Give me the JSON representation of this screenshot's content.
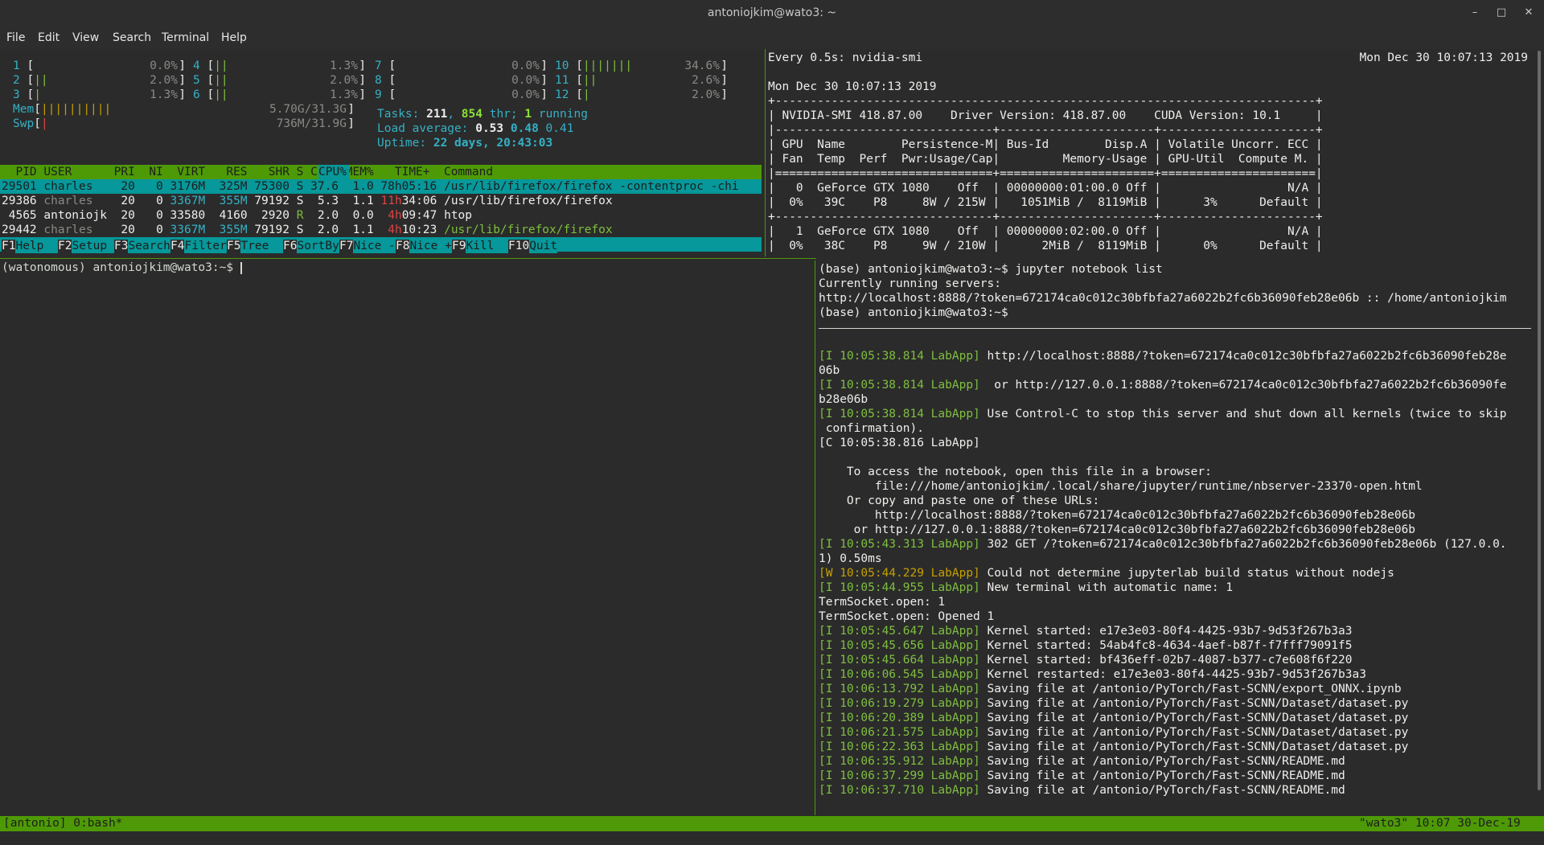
{
  "window": {
    "title": "antoniojkim@wato3: ~"
  },
  "menu": [
    "File",
    "Edit",
    "View",
    "Search",
    "Terminal",
    "Help"
  ],
  "htop": {
    "cpus": [
      {
        "id": "1",
        "pct": "0.0%",
        "bar": ""
      },
      {
        "id": "2",
        "pct": "2.0%",
        "bar": "||"
      },
      {
        "id": "3",
        "pct": "1.3%",
        "bar": "|"
      },
      {
        "id": "4",
        "pct": "1.3%",
        "bar": "||"
      },
      {
        "id": "5",
        "pct": "2.0%",
        "bar": "||"
      },
      {
        "id": "6",
        "pct": "1.3%",
        "bar": "||"
      },
      {
        "id": "7",
        "pct": "0.0%",
        "bar": ""
      },
      {
        "id": "8",
        "pct": "0.0%",
        "bar": ""
      },
      {
        "id": "9",
        "pct": "0.0%",
        "bar": ""
      },
      {
        "id": "10",
        "pct": "34.6%",
        "bar": "|||||||"
      },
      {
        "id": "11",
        "pct": "2.6%",
        "bar": "||"
      },
      {
        "id": "12",
        "pct": "2.0%",
        "bar": "|"
      }
    ],
    "mem": {
      "label": "Mem",
      "bar": "||||||||||",
      "value": "5.70G/31.3G"
    },
    "swp": {
      "label": "Swp",
      "bar": "|",
      "value": "736M/31.9G"
    },
    "tasks": {
      "label": "Tasks:",
      "count": "211",
      "thr": "854",
      "thr_label": "thr;",
      "running": "1",
      "running_label": "running"
    },
    "load": {
      "label": "Load average:",
      "l1": "0.53",
      "l5": "0.48",
      "l15": "0.41"
    },
    "uptime": {
      "label": "Uptime:",
      "value": "22 days, 20:43:03"
    },
    "header": "  PID USER      PRI  NI  VIRT   RES   SHR S CPU% MEM%   TIME+  Command",
    "processes": [
      {
        "pid": "29501",
        "user": "charles",
        "pri": "20",
        "ni": "0",
        "virt": "3176M",
        "res": "325M",
        "shr": "75300",
        "s": "S",
        "cpu": "37.6",
        "mem": "1.0",
        "time": "78h05:16",
        "cmd": "/usr/lib/firefox/firefox -contentproc -chi"
      },
      {
        "pid": "29386",
        "user": "charles",
        "pri": "20",
        "ni": "0",
        "virt": "3367M",
        "res": "355M",
        "shr": "79192",
        "s": "S",
        "cpu": "5.3",
        "mem": "1.1",
        "time_h": "11h",
        "time": "34:06",
        "cmd": "/usr/lib/firefox/firefox"
      },
      {
        "pid": "4565",
        "user": "antoniojk",
        "pri": "20",
        "ni": "0",
        "virt": "33580",
        "res": "4160",
        "shr": "2920",
        "s": "R",
        "cpu": "2.0",
        "mem": "0.0",
        "time_h": "4h",
        "time": "09:47",
        "cmd": "htop"
      },
      {
        "pid": "29442",
        "user": "charles",
        "pri": "20",
        "ni": "0",
        "virt": "3367M",
        "res": "355M",
        "shr": "79192",
        "s": "S",
        "cpu": "2.0",
        "mem": "1.1",
        "time_h": "4h",
        "time": "10:23",
        "cmd": "/usr/lib/firefox/firefox"
      }
    ],
    "fkeys": [
      {
        "key": "F1",
        "label": "Help  "
      },
      {
        "key": "F2",
        "label": "Setup "
      },
      {
        "key": "F3",
        "label": "Search"
      },
      {
        "key": "F4",
        "label": "Filter"
      },
      {
        "key": "F5",
        "label": "Tree  "
      },
      {
        "key": "F6",
        "label": "SortBy"
      },
      {
        "key": "F7",
        "label": "Nice -"
      },
      {
        "key": "F8",
        "label": "Nice +"
      },
      {
        "key": "F9",
        "label": "Kill  "
      },
      {
        "key": "F10",
        "label": "Quit"
      }
    ]
  },
  "nvidia": {
    "lines": [
      {
        "text": "Every 0.5s: nvidia-smi",
        "right": "Mon Dec 30 10:07:13 2019"
      },
      {
        "text": ""
      },
      {
        "text": "Mon Dec 30 10:07:13 2019"
      },
      {
        "text": "+-----------------------------------------------------------------------------+"
      },
      {
        "text": "| NVIDIA-SMI 418.87.00    Driver Version: 418.87.00    CUDA Version: 10.1     |"
      },
      {
        "text": "|-------------------------------+----------------------+----------------------+"
      },
      {
        "text": "| GPU  Name        Persistence-M| Bus-Id        Disp.A | Volatile Uncorr. ECC |"
      },
      {
        "text": "| Fan  Temp  Perf  Pwr:Usage/Cap|         Memory-Usage | GPU-Util  Compute M. |"
      },
      {
        "text": "|===============================+======================+======================|"
      },
      {
        "text": "|   0  GeForce GTX 1080    Off  | 00000000:01:00.0 Off |                  N/A |"
      },
      {
        "text": "|  0%   39C    P8     8W / 215W |   1051MiB /  8119MiB |      3%      Default |"
      },
      {
        "text": "+-------------------------------+----------------------+----------------------+"
      },
      {
        "text": "|   1  GeForce GTX 1080    Off  | 00000000:02:00.0 Off |                  N/A |"
      },
      {
        "text": "|  0%   38C    P8     9W / 210W |      2MiB /  8119MiB |      0%      Default |"
      }
    ]
  },
  "bash": {
    "prompt": "(watonomous) antoniojkim@wato3:~$ "
  },
  "jupyter": {
    "top": [
      "(base) antoniojkim@wato3:~$ jupyter notebook list",
      "Currently running servers:",
      "http://localhost:8888/?token=672174ca0c012c30bfbfa27a6022b2fc6b36090feb28e06b :: /home/antoniojkim",
      "(base) antoniojkim@wato3:~$"
    ],
    "log": [
      {
        "tag": "[I 10:05:38.814 LabApp]",
        "type": "I",
        "msg": " http://localhost:8888/?token=672174ca0c012c30bfbfa27a6022b2fc6b36090feb28e"
      },
      {
        "tag": "",
        "type": "",
        "msg": "06b"
      },
      {
        "tag": "[I 10:05:38.814 LabApp]",
        "type": "I",
        "msg": "  or http://127.0.0.1:8888/?token=672174ca0c012c30bfbfa27a6022b2fc6b36090fe"
      },
      {
        "tag": "",
        "type": "",
        "msg": "b28e06b"
      },
      {
        "tag": "[I 10:05:38.814 LabApp]",
        "type": "I",
        "msg": " Use Control-C to stop this server and shut down all kernels (twice to skip"
      },
      {
        "tag": "",
        "type": "",
        "msg": " confirmation)."
      },
      {
        "tag": "",
        "type": "",
        "msg": "[C 10:05:38.816 LabApp]"
      },
      {
        "tag": "",
        "type": "",
        "msg": ""
      },
      {
        "tag": "",
        "type": "",
        "msg": "    To access the notebook, open this file in a browser:"
      },
      {
        "tag": "",
        "type": "",
        "msg": "        file:///home/antoniojkim/.local/share/jupyter/runtime/nbserver-23370-open.html"
      },
      {
        "tag": "",
        "type": "",
        "msg": "    Or copy and paste one of these URLs:"
      },
      {
        "tag": "",
        "type": "",
        "msg": "        http://localhost:8888/?token=672174ca0c012c30bfbfa27a6022b2fc6b36090feb28e06b"
      },
      {
        "tag": "",
        "type": "",
        "msg": "     or http://127.0.0.1:8888/?token=672174ca0c012c30bfbfa27a6022b2fc6b36090feb28e06b"
      },
      {
        "tag": "[I 10:05:43.313 LabApp]",
        "type": "I",
        "msg": " 302 GET /?token=672174ca0c012c30bfbfa27a6022b2fc6b36090feb28e06b (127.0.0."
      },
      {
        "tag": "",
        "type": "",
        "msg": "1) 0.50ms"
      },
      {
        "tag": "[W 10:05:44.229 LabApp]",
        "type": "W",
        "msg": " Could not determine jupyterlab build status without nodejs"
      },
      {
        "tag": "[I 10:05:44.955 LabApp]",
        "type": "I",
        "msg": " New terminal with automatic name: 1"
      },
      {
        "tag": "",
        "type": "",
        "msg": "TermSocket.open: 1"
      },
      {
        "tag": "",
        "type": "",
        "msg": "TermSocket.open: Opened 1"
      },
      {
        "tag": "[I 10:05:45.647 LabApp]",
        "type": "I",
        "msg": " Kernel started: e17e3e03-80f4-4425-93b7-9d53f267b3a3"
      },
      {
        "tag": "[I 10:05:45.656 LabApp]",
        "type": "I",
        "msg": " Kernel started: 54ab4fc8-4634-4aef-b87f-f7fff79091f5"
      },
      {
        "tag": "[I 10:05:45.664 LabApp]",
        "type": "I",
        "msg": " Kernel started: bf436eff-02b7-4087-b377-c7e608f6f220"
      },
      {
        "tag": "[I 10:06:06.545 LabApp]",
        "type": "I",
        "msg": " Kernel restarted: e17e3e03-80f4-4425-93b7-9d53f267b3a3"
      },
      {
        "tag": "[I 10:06:13.792 LabApp]",
        "type": "I",
        "msg": " Saving file at /antonio/PyTorch/Fast-SCNN/export_ONNX.ipynb"
      },
      {
        "tag": "[I 10:06:19.279 LabApp]",
        "type": "I",
        "msg": " Saving file at /antonio/PyTorch/Fast-SCNN/Dataset/dataset.py"
      },
      {
        "tag": "[I 10:06:20.389 LabApp]",
        "type": "I",
        "msg": " Saving file at /antonio/PyTorch/Fast-SCNN/Dataset/dataset.py"
      },
      {
        "tag": "[I 10:06:21.575 LabApp]",
        "type": "I",
        "msg": " Saving file at /antonio/PyTorch/Fast-SCNN/Dataset/dataset.py"
      },
      {
        "tag": "[I 10:06:22.363 LabApp]",
        "type": "I",
        "msg": " Saving file at /antonio/PyTorch/Fast-SCNN/Dataset/dataset.py"
      },
      {
        "tag": "[I 10:06:35.912 LabApp]",
        "type": "I",
        "msg": " Saving file at /antonio/PyTorch/Fast-SCNN/README.md"
      },
      {
        "tag": "[I 10:06:37.299 LabApp]",
        "type": "I",
        "msg": " Saving file at /antonio/PyTorch/Fast-SCNN/README.md"
      },
      {
        "tag": "[I 10:06:37.710 LabApp]",
        "type": "I",
        "msg": " Saving file at /antonio/PyTorch/Fast-SCNN/README.md"
      }
    ]
  },
  "tmux": {
    "left": "[antonio] 0:bash*",
    "right": "\"wato3\" 10:07 30-Dec-19"
  },
  "colors": {
    "accent": "#4e9a06",
    "cyan": "#06989a",
    "bg": "#2b2b2b"
  }
}
